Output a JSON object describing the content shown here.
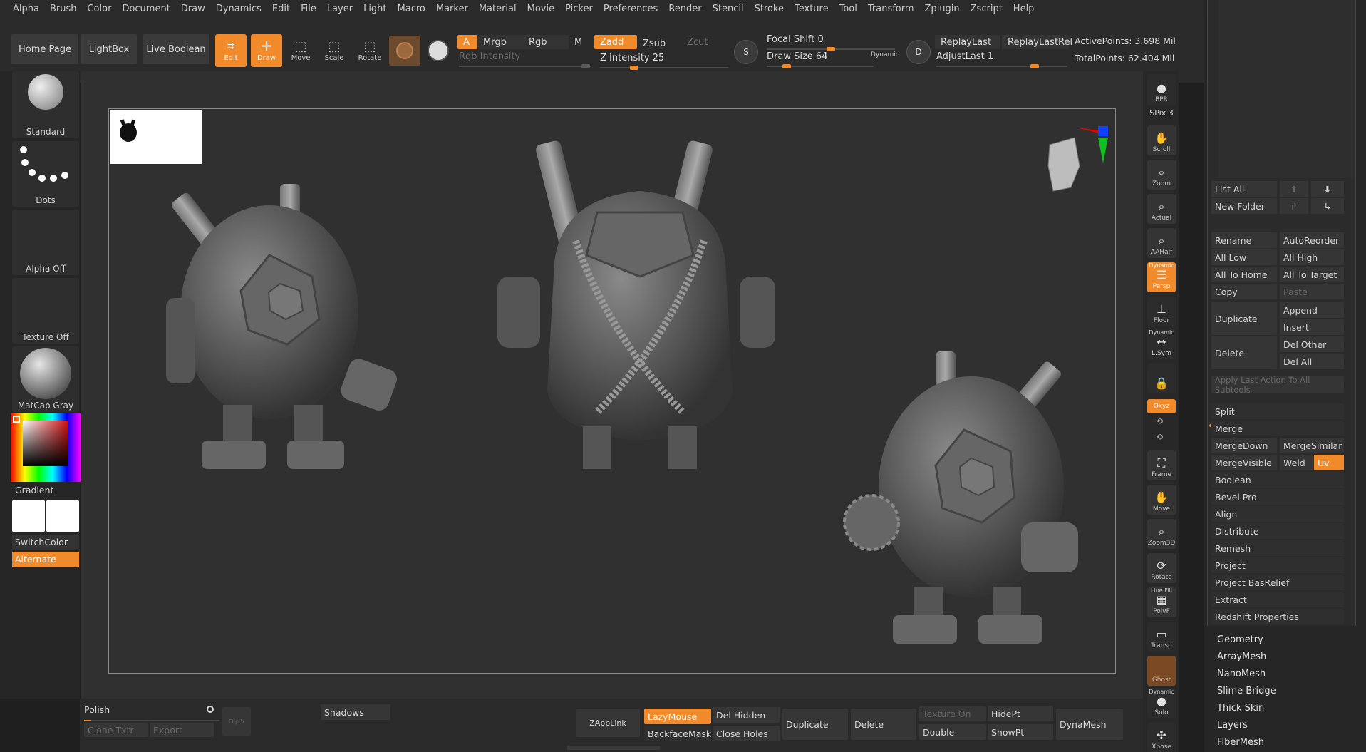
{
  "menubar": [
    "Alpha",
    "Brush",
    "Color",
    "Document",
    "Draw",
    "Dynamics",
    "Edit",
    "File",
    "Layer",
    "Light",
    "Macro",
    "Marker",
    "Material",
    "Movie",
    "Picker",
    "Preferences",
    "Render",
    "Stencil",
    "Stroke",
    "Texture",
    "Tool",
    "Transform",
    "Zplugin",
    "Zscript",
    "Help"
  ],
  "toolbar": {
    "home_page": "Home Page",
    "lightbox": "LightBox",
    "live_boolean": "Live Boolean",
    "edit": "Edit",
    "draw": "Draw",
    "move": "Move",
    "scale": "Scale",
    "rotate": "Rotate",
    "a": "A",
    "mrgb": "Mrgb",
    "rgb": "Rgb",
    "m": "M",
    "zadd": "Zadd",
    "zsub": "Zsub",
    "zcut": "Zcut",
    "rgb_intensity": "Rgb Intensity",
    "z_intensity": "Z Intensity 25",
    "z_intensity_value": 25,
    "focal_shift": "Focal Shift 0",
    "focal_shift_value": 0,
    "draw_size": "Draw Size 64",
    "draw_size_value": 64,
    "dynamic": "Dynamic",
    "s_btn": "S",
    "d_btn": "D",
    "replay_last": "ReplayLast",
    "replay_last_rel": "ReplayLastRel",
    "adjust_last": "AdjustLast 1",
    "active_points": "ActivePoints: 3.698 Mil",
    "total_points": "TotalPoints: 62.404 Mil"
  },
  "leftshelf": {
    "brush": "Standard",
    "stroke": "Dots",
    "alpha": "Alpha Off",
    "texture": "Texture Off",
    "material": "MatCap Gray",
    "gradient": "Gradient",
    "switchcolor": "SwitchColor",
    "alternate": "Alternate"
  },
  "rightbar": {
    "bpr": "BPR",
    "spix": "SPix 3",
    "scroll": "Scroll",
    "zoom": "Zoom",
    "actual": "Actual",
    "aahalf": "AAHalf",
    "dynamic_top": "Dynamic",
    "persp": "Persp",
    "floor": "Floor",
    "dynamic_lsym": "Dynamic",
    "lsym": "L.Sym",
    "xyz": "Qxyz",
    "frame": "Frame",
    "move": "Move",
    "zoom3d": "Zoom3D",
    "rotate": "Rotate",
    "line_fill": "Line Fill",
    "polyf": "PolyF",
    "transp": "Transp",
    "ghost": "Ghost",
    "dynamic_solo": "Dynamic",
    "solo": "Solo",
    "xpose": "Xpose"
  },
  "palette": {
    "list_all": "List All",
    "new_folder": "New Folder",
    "rename": "Rename",
    "autoreorder": "AutoReorder",
    "all_low": "All Low",
    "all_high": "All High",
    "all_to_home": "All To Home",
    "all_to_target": "All To Target",
    "copy": "Copy",
    "paste": "Paste",
    "duplicate": "Duplicate",
    "append": "Append",
    "insert": "Insert",
    "delete": "Delete",
    "del_other": "Del Other",
    "del_all": "Del All",
    "apply_last": "Apply Last Action To All Subtools",
    "split": "Split",
    "merge": "Merge",
    "mergedown": "MergeDown",
    "mergesimilar": "MergeSimilar",
    "mergevisible": "MergeVisible",
    "weld": "Weld",
    "uv": "Uv",
    "boolean": "Boolean",
    "bevel_pro": "Bevel Pro",
    "align": "Align",
    "distribute": "Distribute",
    "remesh": "Remesh",
    "project": "Project",
    "project_basrelief": "Project BasRelief",
    "extract": "Extract",
    "redshift": "Redshift Properties",
    "sub": [
      "Geometry",
      "ArrayMesh",
      "NanoMesh",
      "Slime Bridge",
      "Thick Skin",
      "Layers",
      "FiberMesh"
    ]
  },
  "bottombar": {
    "polish": "Polish",
    "clone_txtr": "Clone Txtr",
    "export": "Export",
    "flip_v": "Flip V",
    "shadows": "Shadows",
    "zapplink": "ZAppLink",
    "lazymouse": "LazyMouse",
    "backfacemask": "BackfaceMask",
    "del_hidden": "Del Hidden",
    "close_holes": "Close Holes",
    "duplicate": "Duplicate",
    "delete": "Delete",
    "texture_on": "Texture On",
    "double": "Double",
    "hidept": "HidePt",
    "showpt": "ShowPt",
    "dynamesh": "DynaMesh"
  },
  "colors": {
    "accent": "#f08a2a",
    "bg": "#303030",
    "panel": "#2b2b2b"
  }
}
